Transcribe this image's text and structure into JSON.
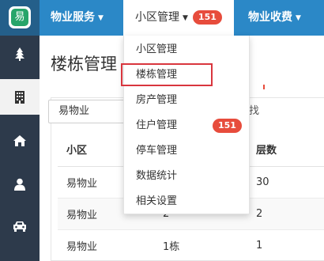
{
  "brand": {
    "logo_char": "易"
  },
  "topnav": {
    "items": [
      {
        "label": "物业服务"
      },
      {
        "label": "小区管理",
        "badge": "151"
      },
      {
        "label": "物业收费"
      }
    ]
  },
  "sidebar": {
    "items": [
      {
        "icon": "tree-icon"
      },
      {
        "icon": "building-icon",
        "active": true
      },
      {
        "icon": "home-icon"
      },
      {
        "icon": "user-icon"
      },
      {
        "icon": "car-icon"
      }
    ]
  },
  "page": {
    "title": "楼栋管理"
  },
  "filter": {
    "community_value": "易物业",
    "search_label": "查找"
  },
  "table": {
    "headers": [
      "小区",
      "",
      "层数"
    ],
    "rows": [
      [
        "易物业",
        "",
        "30"
      ],
      [
        "易物业",
        "2",
        "2"
      ],
      [
        "易物业",
        "1栋",
        "1"
      ]
    ]
  },
  "dropdown": {
    "items": [
      {
        "label": "小区管理"
      },
      {
        "label": "楼栋管理",
        "highlighted": true
      },
      {
        "label": "房产管理"
      },
      {
        "label": "住户管理",
        "badge": "151"
      },
      {
        "label": "停车管理"
      },
      {
        "label": "数据统计"
      },
      {
        "label": "相关设置"
      }
    ]
  },
  "colors": {
    "topbar": "#2b88c7",
    "sidebar": "#2d3a4b",
    "badge": "#e74c3c",
    "highlight": "#d9363e"
  }
}
